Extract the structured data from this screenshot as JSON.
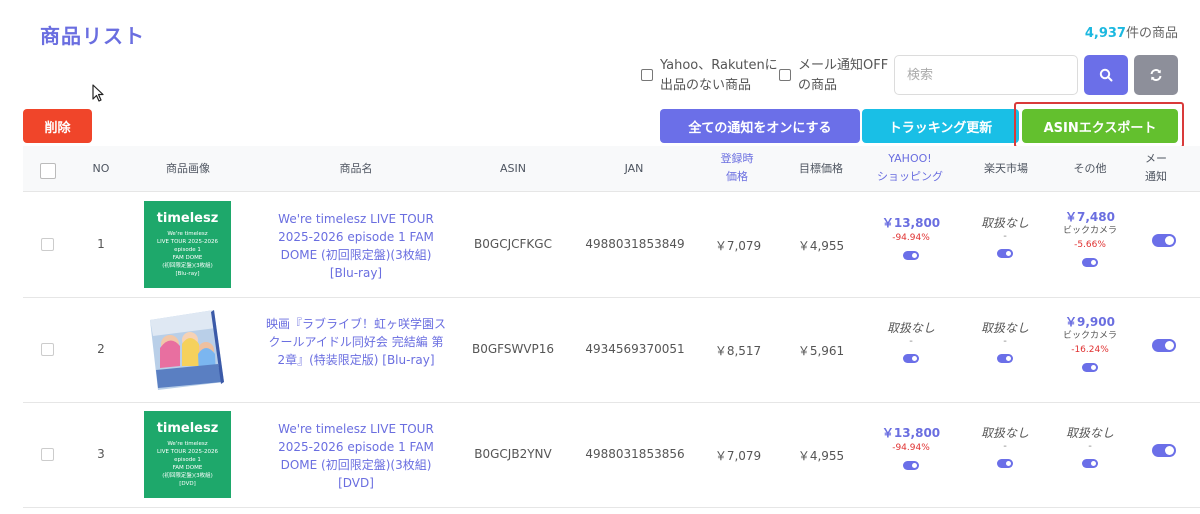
{
  "page": {
    "title": "商品リスト",
    "count_number": "4,937",
    "count_suffix": "件の商品"
  },
  "filters": {
    "no_listing_line1": "Yahoo、Rakutenに",
    "no_listing_line2": "出品のない商品",
    "mail_off_line1": "メール通知OFF",
    "mail_off_line2": "の商品"
  },
  "search": {
    "placeholder": "検索"
  },
  "buttons": {
    "delete": "削除",
    "all_notify_on": "全ての通知をオンにする",
    "tracking_update": "トラッキング更新",
    "asin_export": "ASINエクスポート"
  },
  "icons": {
    "search": "search-icon",
    "reset": "sync-icon"
  },
  "colors": {
    "accent": "#6b6fe8",
    "delete": "#f0452a",
    "tracking": "#19bfe6",
    "export": "#63c02e",
    "highlight_frame": "#d93a3a",
    "negative": "#e03131"
  },
  "table": {
    "headers": {
      "no": "NO",
      "image": "商品画像",
      "name": "商品名",
      "asin": "ASIN",
      "jan": "JAN",
      "reg_price_1": "登録時",
      "reg_price_2": "価格",
      "target_price": "目標価格",
      "yahoo_1": "YAHOO!",
      "yahoo_2": "ショッピング",
      "rakuten": "楽天市場",
      "other": "その他",
      "mail_1": "メー",
      "mail_2": "通知"
    },
    "rows": [
      {
        "no": "1",
        "image_title": "timelesz",
        "image_lines": [
          "We're timelesz",
          "LIVE TOUR 2025-2026",
          "episode 1",
          "FAM DOME",
          "(初回限定盤)(3枚組)",
          "[Blu-ray]"
        ],
        "name": "We're timelesz LIVE TOUR 2025-2026 episode 1 FAM DOME (初回限定盤)(3枚組) [Blu-ray]",
        "asin": "B0GCJCFKGC",
        "jan": "4988031853849",
        "reg_price": "￥7,079",
        "target_price": "￥4,955",
        "yahoo": {
          "price": "￥13,800",
          "pct": "-94.94%"
        },
        "rakuten": {
          "none": "取扱なし",
          "dash": "-"
        },
        "other": {
          "price": "￥7,480",
          "shop": "ビックカメラ",
          "pct": "-5.66%"
        }
      },
      {
        "no": "2",
        "name": "映画『ラブライブ！虹ヶ咲学園スクールアイドル同好会 完結編 第2章』(特装限定版) [Blu-ray]",
        "asin": "B0GFSWVP16",
        "jan": "4934569370051",
        "reg_price": "￥8,517",
        "target_price": "￥5,961",
        "yahoo": {
          "none": "取扱なし",
          "dash": "-"
        },
        "rakuten": {
          "none": "取扱なし",
          "dash": "-"
        },
        "other": {
          "price": "￥9,900",
          "shop": "ビックカメラ",
          "pct": "-16.24%"
        }
      },
      {
        "no": "3",
        "image_title": "timelesz",
        "image_lines": [
          "We're timelesz",
          "LIVE TOUR 2025-2026",
          "episode 1",
          "FAM DOME",
          "(初回限定盤)(3枚組)",
          "[DVD]"
        ],
        "name": "We're timelesz LIVE TOUR 2025-2026 episode 1 FAM DOME (初回限定盤)(3枚組) [DVD]",
        "asin": "B0GCJB2YNV",
        "jan": "4988031853856",
        "reg_price": "￥7,079",
        "target_price": "￥4,955",
        "yahoo": {
          "price": "￥13,800",
          "pct": "-94.94%"
        },
        "rakuten": {
          "none": "取扱なし",
          "dash": "-"
        },
        "other": {
          "none": "取扱なし",
          "dash": "-"
        }
      }
    ]
  }
}
